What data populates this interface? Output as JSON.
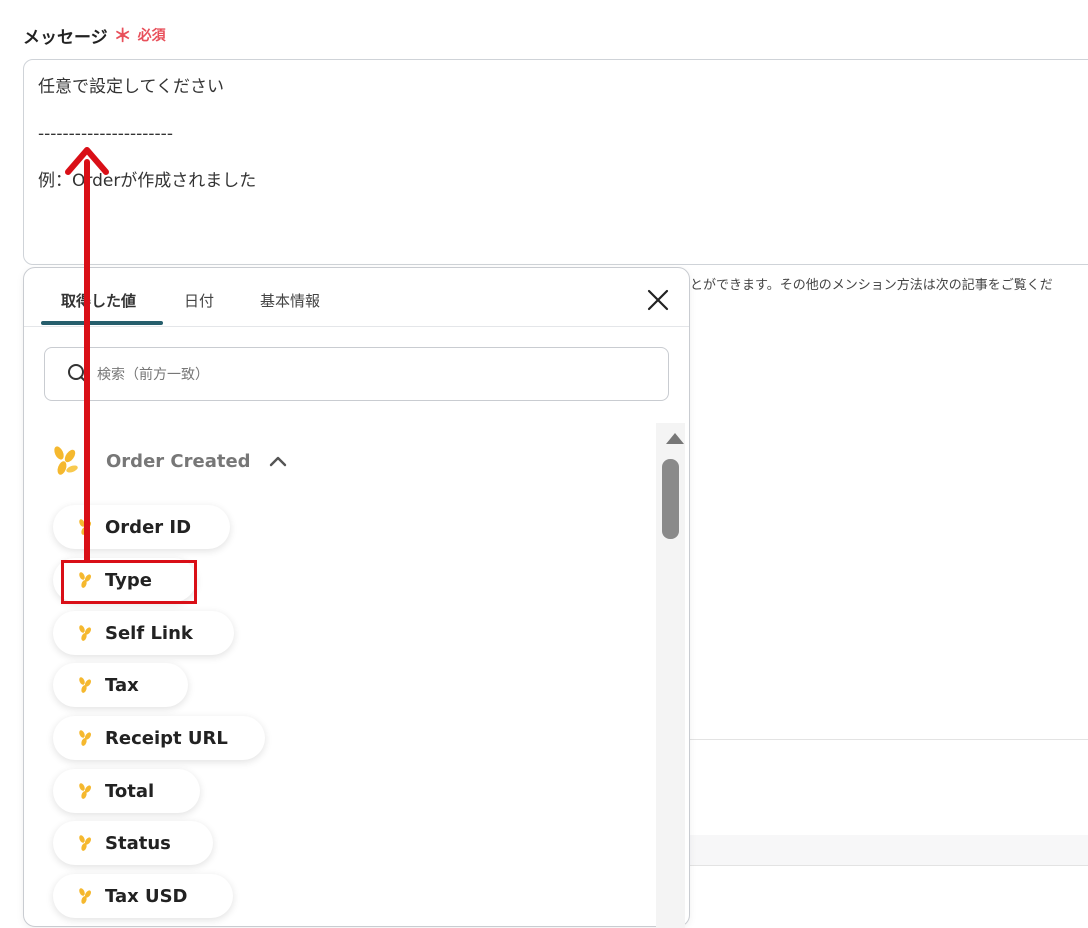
{
  "field": {
    "label": "メッセージ",
    "required_mark": "＊",
    "required_text": "必須"
  },
  "message": {
    "lines": [
      "任意で設定してください",
      "----------------------",
      "例：Orderが作成されました"
    ]
  },
  "hint": "とができます。その他のメンション方法は次の記事をご覧くだ",
  "popup": {
    "tabs": [
      {
        "label": "取得した値",
        "active": true
      },
      {
        "label": "日付",
        "active": false
      },
      {
        "label": "基本情報",
        "active": false
      }
    ],
    "search": {
      "placeholder": "検索（前方一致）",
      "value": ""
    },
    "group": {
      "title": "Order Created",
      "items": [
        "Order ID",
        "Type",
        "Self Link",
        "Tax",
        "Receipt URL",
        "Total",
        "Status",
        "Tax USD"
      ]
    }
  },
  "colors": {
    "accent": "#265e6c",
    "required": "#e8505b",
    "highlight": "#d90f17",
    "icon": "#f5b82e"
  }
}
